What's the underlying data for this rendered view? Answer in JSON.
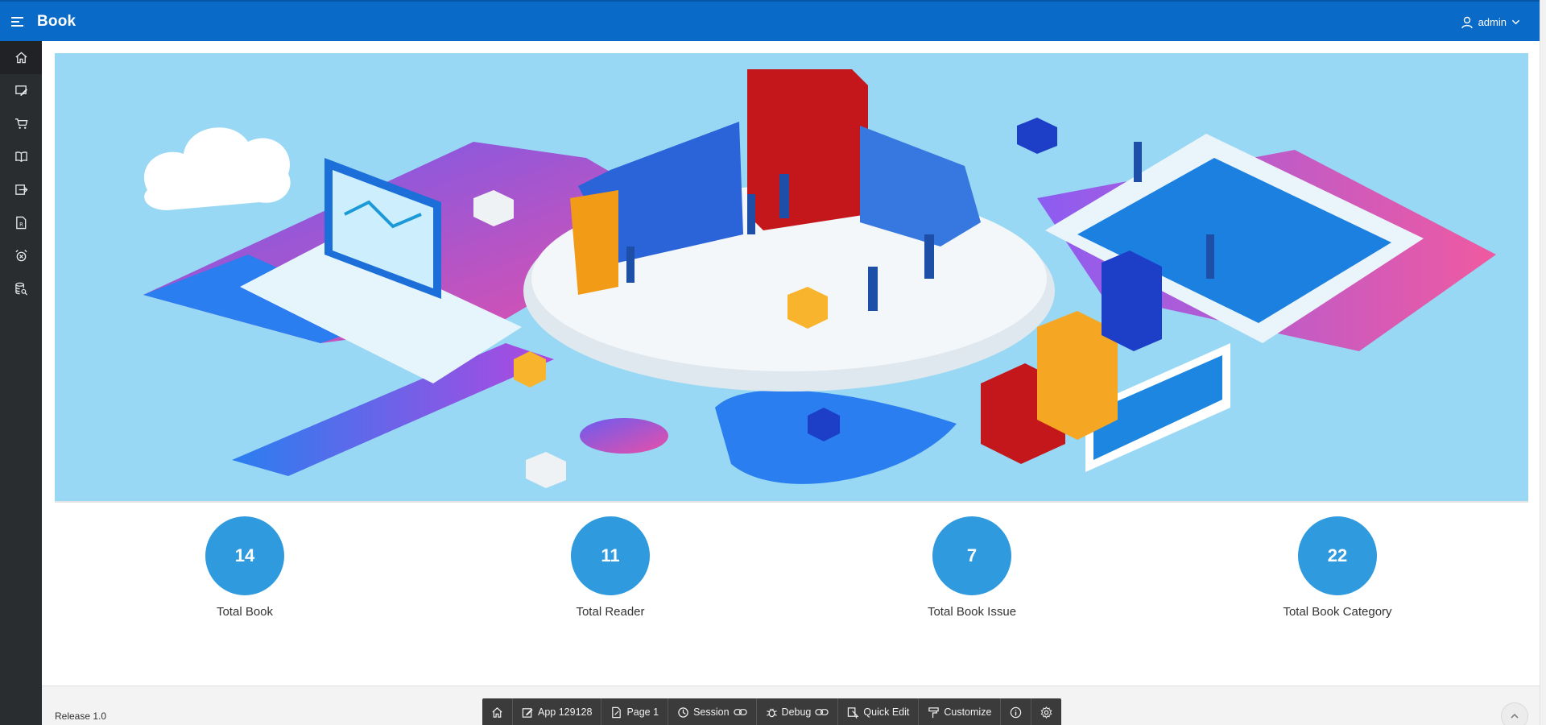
{
  "header": {
    "title": "Book",
    "menu_icon": "hamburger-menu-icon",
    "user_name": "admin",
    "user_icon": "user-icon",
    "bg_color": "#0a6ac8"
  },
  "sidebar": {
    "bg_color": "#2a2d30",
    "items": [
      {
        "icon": "home-icon",
        "active": true
      },
      {
        "icon": "edit-form-icon"
      },
      {
        "icon": "cart-icon"
      },
      {
        "icon": "open-book-icon"
      },
      {
        "icon": "sign-out-icon"
      },
      {
        "icon": "reader-document-icon"
      },
      {
        "icon": "alarm-clock-icon"
      },
      {
        "icon": "database-search-icon"
      }
    ]
  },
  "hero": {
    "image": "isometric-data-analytics-illustration",
    "bg_color": "#99d8f4"
  },
  "stats": [
    {
      "value": "14",
      "label": "Total Book"
    },
    {
      "value": "11",
      "label": "Total Reader"
    },
    {
      "value": "7",
      "label": "Total Book Issue"
    },
    {
      "value": "22",
      "label": "Total Book Category"
    }
  ],
  "stat_color": "#2f9ade",
  "footer": {
    "release": "Release 1.0",
    "devbar": [
      {
        "icon": "home-icon",
        "label": ""
      },
      {
        "icon": "edit-icon",
        "label": "App 129128"
      },
      {
        "icon": "page-icon",
        "label": "Page 1"
      },
      {
        "icon": "session-icon",
        "label": "Session"
      },
      {
        "icon": "debug-icon",
        "label": "Debug"
      },
      {
        "icon": "quick-edit-icon",
        "label": "Quick Edit"
      },
      {
        "icon": "customize-icon",
        "label": "Customize"
      },
      {
        "icon": "info-icon",
        "label": ""
      },
      {
        "icon": "gear-icon",
        "label": ""
      }
    ]
  }
}
